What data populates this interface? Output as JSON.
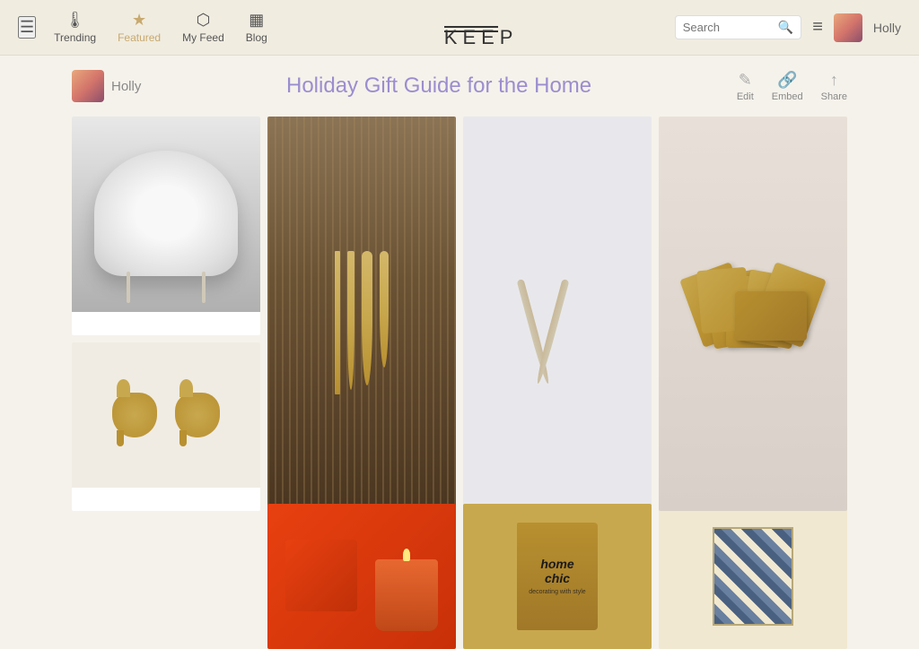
{
  "header": {
    "menu_icon": "☰",
    "nav": [
      {
        "id": "trending",
        "label": "Trending",
        "icon": "🌡"
      },
      {
        "id": "featured",
        "label": "Featured",
        "icon": "★",
        "active": true
      },
      {
        "id": "myfeed",
        "label": "My Feed",
        "icon": "⬡"
      },
      {
        "id": "blog",
        "label": "Blog",
        "icon": "▦"
      }
    ],
    "logo": "KEEP",
    "search_placeholder": "Search",
    "username": "Holly"
  },
  "page": {
    "username": "Holly",
    "title": "Holiday Gift Guide for the Home",
    "actions": [
      {
        "id": "edit",
        "label": "Edit",
        "icon": "✎"
      },
      {
        "id": "embed",
        "label": "Embed",
        "icon": "🔗"
      },
      {
        "id": "share",
        "label": "Share",
        "icon": "↑"
      }
    ]
  },
  "grid": {
    "items": [
      {
        "id": "fur-chair",
        "alt": "Fluffy white fur chair",
        "type": "fur-chair"
      },
      {
        "id": "cutlery",
        "alt": "Gold cutlery set",
        "type": "cutlery"
      },
      {
        "id": "spoon-tongs",
        "alt": "Gold serving tongs",
        "type": "spoon"
      },
      {
        "id": "gold-cards",
        "alt": "Gold playing cards",
        "type": "cards"
      },
      {
        "id": "gold-elephants",
        "alt": "Gold elephant figurines",
        "type": "elephants"
      },
      {
        "id": "candle",
        "alt": "Diptyque candle",
        "type": "candle"
      },
      {
        "id": "home-chic-book",
        "alt": "Home Chic book",
        "type": "book"
      },
      {
        "id": "pattern",
        "alt": "Blue geometric pattern",
        "type": "pattern"
      }
    ]
  }
}
